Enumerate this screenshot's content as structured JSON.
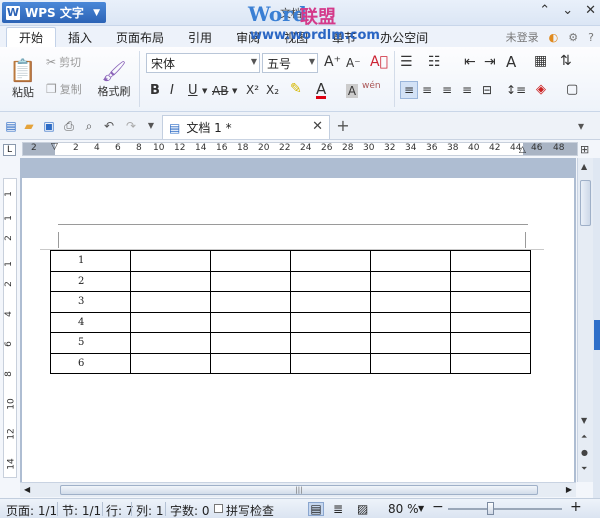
{
  "app": {
    "name": "WPS 文字",
    "logo_letter": "W",
    "title_word": "Word",
    "title_lianmeng": "联盟",
    "title_file": "文档",
    "watermark_url": "www.wordlm.com"
  },
  "window_controls": {
    "minimize": "⌃",
    "restore": "⌄",
    "close": "✕"
  },
  "tabs": [
    {
      "label": "开始",
      "active": true
    },
    {
      "label": "插入"
    },
    {
      "label": "页面布局"
    },
    {
      "label": "引用"
    },
    {
      "label": "审阅"
    },
    {
      "label": "视图"
    },
    {
      "label": "章节"
    },
    {
      "label": "办公空间"
    }
  ],
  "tabs_right": {
    "login": "未登录"
  },
  "ribbon": {
    "paste": "粘贴",
    "cut": "剪切",
    "copy": "复制",
    "format_painter": "格式刷",
    "font_name": "宋体",
    "font_size": "五号",
    "bold": "B",
    "italic": "I",
    "underline": "U",
    "strike": "AB",
    "superscript": "X²",
    "subscript": "X₂",
    "font_color": "A",
    "char_shade": "A",
    "phonetic": "wén",
    "grow_font": "A⁺",
    "shrink_font": "A⁻"
  },
  "quickbar": {
    "doc_tab": "文档 1 *",
    "new_tab": "+"
  },
  "ruler": {
    "corner": "L",
    "numbers": [
      "2",
      "2",
      "4",
      "6",
      "8",
      "10",
      "12",
      "14",
      "16",
      "18",
      "20",
      "22",
      "24",
      "26",
      "28",
      "30",
      "32",
      "34",
      "36",
      "38",
      "40",
      "42",
      "44",
      "46",
      "48"
    ],
    "vertical_numbers": [
      "1",
      "1",
      "2",
      "1",
      "2",
      "4",
      "6",
      "8",
      "10",
      "12",
      "14"
    ]
  },
  "table": {
    "rows": [
      [
        "1",
        "",
        "",
        "",
        "",
        ""
      ],
      [
        "2",
        "",
        "",
        "",
        "",
        ""
      ],
      [
        "3",
        "",
        "",
        "",
        "",
        ""
      ],
      [
        "4",
        "",
        "",
        "",
        "",
        ""
      ],
      [
        "5",
        "",
        "",
        "",
        "",
        ""
      ],
      [
        "6",
        "",
        "",
        "",
        "",
        ""
      ]
    ]
  },
  "status": {
    "page": "页面: 1/1",
    "section": "节: 1/1",
    "row": "行: 7",
    "col": "列: 1",
    "words": "字数: 0",
    "spellcheck": "拼写检查",
    "zoom": "80 %",
    "zoom_value_percent": 80
  }
}
